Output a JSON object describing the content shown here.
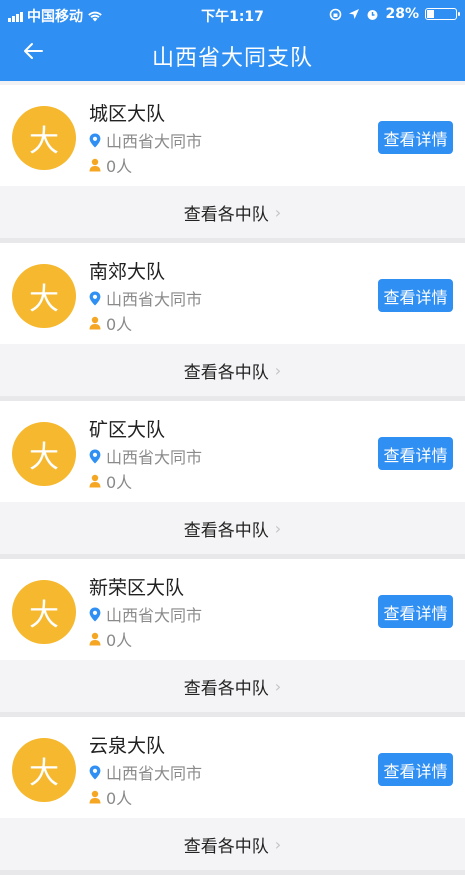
{
  "status_bar": {
    "carrier": "中国移动",
    "time": "下午1:17",
    "battery": "28%",
    "battery_level": 0.28
  },
  "header": {
    "title": "山西省大同支队"
  },
  "teams": [
    {
      "avatar": "大",
      "name": "城区大队",
      "location": "山西省大同市",
      "count": "0人",
      "detail_label": "查看详情",
      "sub_link": "查看各中队"
    },
    {
      "avatar": "大",
      "name": "南郊大队",
      "location": "山西省大同市",
      "count": "0人",
      "detail_label": "查看详情",
      "sub_link": "查看各中队"
    },
    {
      "avatar": "大",
      "name": "矿区大队",
      "location": "山西省大同市",
      "count": "0人",
      "detail_label": "查看详情",
      "sub_link": "查看各中队"
    },
    {
      "avatar": "大",
      "name": "新荣区大队",
      "location": "山西省大同市",
      "count": "0人",
      "detail_label": "查看详情",
      "sub_link": "查看各中队"
    },
    {
      "avatar": "大",
      "name": "云泉大队",
      "location": "山西省大同市",
      "count": "0人",
      "detail_label": "查看详情",
      "sub_link": "查看各中队"
    }
  ],
  "colors": {
    "primary": "#2f8ff3",
    "avatar_bg": "#f5b82e",
    "pin": "#2f8ff3",
    "person": "#f5a623"
  },
  "icons": {
    "back": "arrow-left-icon",
    "location": "location-pin-icon",
    "person": "person-icon",
    "chevron": "chevron-right-icon"
  }
}
